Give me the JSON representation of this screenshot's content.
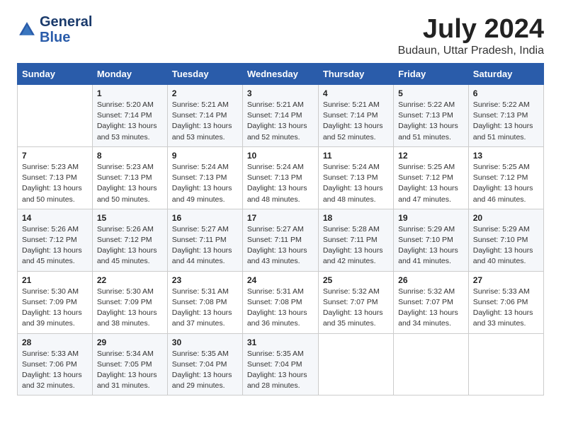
{
  "logo": {
    "line1": "General",
    "line2": "Blue"
  },
  "title": "July 2024",
  "location": "Budaun, Uttar Pradesh, India",
  "days_of_week": [
    "Sunday",
    "Monday",
    "Tuesday",
    "Wednesday",
    "Thursday",
    "Friday",
    "Saturday"
  ],
  "weeks": [
    [
      {
        "day": "",
        "sunrise": "",
        "sunset": "",
        "daylight": ""
      },
      {
        "day": "1",
        "sunrise": "Sunrise: 5:20 AM",
        "sunset": "Sunset: 7:14 PM",
        "daylight": "Daylight: 13 hours and 53 minutes."
      },
      {
        "day": "2",
        "sunrise": "Sunrise: 5:21 AM",
        "sunset": "Sunset: 7:14 PM",
        "daylight": "Daylight: 13 hours and 53 minutes."
      },
      {
        "day": "3",
        "sunrise": "Sunrise: 5:21 AM",
        "sunset": "Sunset: 7:14 PM",
        "daylight": "Daylight: 13 hours and 52 minutes."
      },
      {
        "day": "4",
        "sunrise": "Sunrise: 5:21 AM",
        "sunset": "Sunset: 7:14 PM",
        "daylight": "Daylight: 13 hours and 52 minutes."
      },
      {
        "day": "5",
        "sunrise": "Sunrise: 5:22 AM",
        "sunset": "Sunset: 7:13 PM",
        "daylight": "Daylight: 13 hours and 51 minutes."
      },
      {
        "day": "6",
        "sunrise": "Sunrise: 5:22 AM",
        "sunset": "Sunset: 7:13 PM",
        "daylight": "Daylight: 13 hours and 51 minutes."
      }
    ],
    [
      {
        "day": "7",
        "sunrise": "Sunrise: 5:23 AM",
        "sunset": "Sunset: 7:13 PM",
        "daylight": "Daylight: 13 hours and 50 minutes."
      },
      {
        "day": "8",
        "sunrise": "Sunrise: 5:23 AM",
        "sunset": "Sunset: 7:13 PM",
        "daylight": "Daylight: 13 hours and 50 minutes."
      },
      {
        "day": "9",
        "sunrise": "Sunrise: 5:24 AM",
        "sunset": "Sunset: 7:13 PM",
        "daylight": "Daylight: 13 hours and 49 minutes."
      },
      {
        "day": "10",
        "sunrise": "Sunrise: 5:24 AM",
        "sunset": "Sunset: 7:13 PM",
        "daylight": "Daylight: 13 hours and 48 minutes."
      },
      {
        "day": "11",
        "sunrise": "Sunrise: 5:24 AM",
        "sunset": "Sunset: 7:13 PM",
        "daylight": "Daylight: 13 hours and 48 minutes."
      },
      {
        "day": "12",
        "sunrise": "Sunrise: 5:25 AM",
        "sunset": "Sunset: 7:12 PM",
        "daylight": "Daylight: 13 hours and 47 minutes."
      },
      {
        "day": "13",
        "sunrise": "Sunrise: 5:25 AM",
        "sunset": "Sunset: 7:12 PM",
        "daylight": "Daylight: 13 hours and 46 minutes."
      }
    ],
    [
      {
        "day": "14",
        "sunrise": "Sunrise: 5:26 AM",
        "sunset": "Sunset: 7:12 PM",
        "daylight": "Daylight: 13 hours and 45 minutes."
      },
      {
        "day": "15",
        "sunrise": "Sunrise: 5:26 AM",
        "sunset": "Sunset: 7:12 PM",
        "daylight": "Daylight: 13 hours and 45 minutes."
      },
      {
        "day": "16",
        "sunrise": "Sunrise: 5:27 AM",
        "sunset": "Sunset: 7:11 PM",
        "daylight": "Daylight: 13 hours and 44 minutes."
      },
      {
        "day": "17",
        "sunrise": "Sunrise: 5:27 AM",
        "sunset": "Sunset: 7:11 PM",
        "daylight": "Daylight: 13 hours and 43 minutes."
      },
      {
        "day": "18",
        "sunrise": "Sunrise: 5:28 AM",
        "sunset": "Sunset: 7:11 PM",
        "daylight": "Daylight: 13 hours and 42 minutes."
      },
      {
        "day": "19",
        "sunrise": "Sunrise: 5:29 AM",
        "sunset": "Sunset: 7:10 PM",
        "daylight": "Daylight: 13 hours and 41 minutes."
      },
      {
        "day": "20",
        "sunrise": "Sunrise: 5:29 AM",
        "sunset": "Sunset: 7:10 PM",
        "daylight": "Daylight: 13 hours and 40 minutes."
      }
    ],
    [
      {
        "day": "21",
        "sunrise": "Sunrise: 5:30 AM",
        "sunset": "Sunset: 7:09 PM",
        "daylight": "Daylight: 13 hours and 39 minutes."
      },
      {
        "day": "22",
        "sunrise": "Sunrise: 5:30 AM",
        "sunset": "Sunset: 7:09 PM",
        "daylight": "Daylight: 13 hours and 38 minutes."
      },
      {
        "day": "23",
        "sunrise": "Sunrise: 5:31 AM",
        "sunset": "Sunset: 7:08 PM",
        "daylight": "Daylight: 13 hours and 37 minutes."
      },
      {
        "day": "24",
        "sunrise": "Sunrise: 5:31 AM",
        "sunset": "Sunset: 7:08 PM",
        "daylight": "Daylight: 13 hours and 36 minutes."
      },
      {
        "day": "25",
        "sunrise": "Sunrise: 5:32 AM",
        "sunset": "Sunset: 7:07 PM",
        "daylight": "Daylight: 13 hours and 35 minutes."
      },
      {
        "day": "26",
        "sunrise": "Sunrise: 5:32 AM",
        "sunset": "Sunset: 7:07 PM",
        "daylight": "Daylight: 13 hours and 34 minutes."
      },
      {
        "day": "27",
        "sunrise": "Sunrise: 5:33 AM",
        "sunset": "Sunset: 7:06 PM",
        "daylight": "Daylight: 13 hours and 33 minutes."
      }
    ],
    [
      {
        "day": "28",
        "sunrise": "Sunrise: 5:33 AM",
        "sunset": "Sunset: 7:06 PM",
        "daylight": "Daylight: 13 hours and 32 minutes."
      },
      {
        "day": "29",
        "sunrise": "Sunrise: 5:34 AM",
        "sunset": "Sunset: 7:05 PM",
        "daylight": "Daylight: 13 hours and 31 minutes."
      },
      {
        "day": "30",
        "sunrise": "Sunrise: 5:35 AM",
        "sunset": "Sunset: 7:04 PM",
        "daylight": "Daylight: 13 hours and 29 minutes."
      },
      {
        "day": "31",
        "sunrise": "Sunrise: 5:35 AM",
        "sunset": "Sunset: 7:04 PM",
        "daylight": "Daylight: 13 hours and 28 minutes."
      },
      {
        "day": "",
        "sunrise": "",
        "sunset": "",
        "daylight": ""
      },
      {
        "day": "",
        "sunrise": "",
        "sunset": "",
        "daylight": ""
      },
      {
        "day": "",
        "sunrise": "",
        "sunset": "",
        "daylight": ""
      }
    ]
  ]
}
